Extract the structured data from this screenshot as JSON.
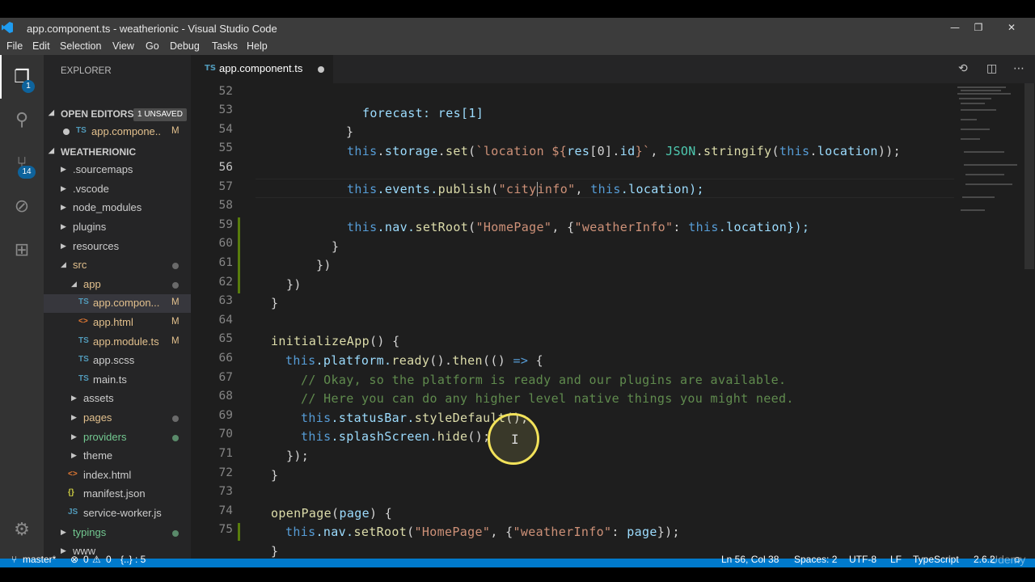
{
  "window": {
    "title": "app.component.ts - weatherionic - Visual Studio Code",
    "controls": [
      "—",
      "❐",
      "✕"
    ]
  },
  "menu": [
    "File",
    "Edit",
    "Selection",
    "View",
    "Go",
    "Debug",
    "Tasks",
    "Help"
  ],
  "activity": {
    "explorer_badge": "1",
    "scm_badge": "14"
  },
  "sidebar": {
    "header": "EXPLORER",
    "open_editors": {
      "label": "OPEN EDITORS",
      "badge": "1 UNSAVED",
      "files": [
        {
          "name": "app.compone..",
          "icon": "TS",
          "status": "M"
        }
      ]
    },
    "project": {
      "label": "WEATHERIONIC",
      "items": [
        {
          "name": ".sourcemaps",
          "type": "folder",
          "depth": 1
        },
        {
          "name": ".vscode",
          "type": "folder",
          "depth": 1
        },
        {
          "name": "node_modules",
          "type": "folder",
          "depth": 1
        },
        {
          "name": "plugins",
          "type": "folder",
          "depth": 1
        },
        {
          "name": "resources",
          "type": "folder",
          "depth": 1
        },
        {
          "name": "src",
          "type": "folder-open",
          "depth": 1
        },
        {
          "name": "app",
          "type": "folder-open",
          "depth": 2
        },
        {
          "name": "app.compon...",
          "type": "ts",
          "depth": 3,
          "status": "M"
        },
        {
          "name": "app.html",
          "type": "html",
          "depth": 3,
          "status": "M"
        },
        {
          "name": "app.module.ts",
          "type": "ts",
          "depth": 3,
          "status": "M"
        },
        {
          "name": "app.scss",
          "type": "scss",
          "depth": 3
        },
        {
          "name": "main.ts",
          "type": "ts",
          "depth": 3
        },
        {
          "name": "assets",
          "type": "folder",
          "depth": 2
        },
        {
          "name": "pages",
          "type": "folder",
          "depth": 2
        },
        {
          "name": "providers",
          "type": "folder",
          "depth": 2
        },
        {
          "name": "theme",
          "type": "folder",
          "depth": 2
        },
        {
          "name": "index.html",
          "type": "html",
          "depth": 2
        },
        {
          "name": "manifest.json",
          "type": "json",
          "depth": 2
        },
        {
          "name": "service-worker.js",
          "type": "js",
          "depth": 2
        },
        {
          "name": "typings",
          "type": "folder",
          "depth": 1
        },
        {
          "name": "www",
          "type": "folder",
          "depth": 1
        }
      ]
    }
  },
  "editor": {
    "tab": {
      "icon": "TS",
      "name": "app.component.ts"
    },
    "line_numbers": [
      "52",
      "53",
      "54",
      "55",
      "56",
      "57",
      "58",
      "59",
      "60",
      "61",
      "62",
      "63",
      "64",
      "65",
      "66",
      "67",
      "68",
      "69",
      "70",
      "71",
      "72",
      "73",
      "74",
      "75"
    ],
    "code": {
      "l52": "forecast: res[1]",
      "l53": "}",
      "l54_a": "this",
      "l54_b": ".",
      "l54_c": "storage",
      "l54_d": ".",
      "l54_e": "set",
      "l54_f": "(",
      "l54_g": "`location ${",
      "l54_h": "res",
      "l54_i": "[0].",
      "l54_j": "id",
      "l54_k": "}`",
      "l54_l": ", ",
      "l54_m": "JSON",
      "l54_n": ".",
      "l54_o": "stringify",
      "l54_p": "(",
      "l54_q": "this",
      "l54_r": ".",
      "l54_s": "location",
      "l54_t": "));",
      "l56_a": "this",
      "l56_b": ".events.",
      "l56_c": "publish",
      "l56_d": "(",
      "l56_e": "\"city",
      "l56_f": "info\"",
      "l56_g": ", ",
      "l56_h": "this",
      "l56_i": ".location);",
      "l58_a": "this",
      "l58_b": ".nav.",
      "l58_c": "setRoot",
      "l58_d": "(",
      "l58_e": "\"HomePage\"",
      "l58_f": ", {",
      "l58_g": "\"weatherInfo\"",
      "l58_h": ": ",
      "l58_i": "this",
      "l58_j": ".location});",
      "l59": "}",
      "l60": "})",
      "l61": "})",
      "l62": "}",
      "l64_a": "initializeApp",
      "l64_b": "() {",
      "l65_a": "this",
      "l65_b": ".platform.",
      "l65_c": "ready",
      "l65_d": "().",
      "l65_e": "then",
      "l65_f": "(() ",
      "l65_g": "=>",
      "l65_h": " {",
      "l66": "// Okay, so the platform is ready and our plugins are available.",
      "l67": "// Here you can do any higher level native things you might need.",
      "l68_a": "this",
      "l68_b": ".statusBar.",
      "l68_c": "styleDefault",
      "l68_d": "();",
      "l69_a": "this",
      "l69_b": ".splashScreen.",
      "l69_c": "hide",
      "l69_d": "();",
      "l70": "});",
      "l71": "}",
      "l73_a": "openPage",
      "l73_b": "(",
      "l73_c": "page",
      "l73_d": ") {",
      "l74_a": "this",
      "l74_b": ".nav.",
      "l74_c": "setRoot",
      "l74_d": "(",
      "l74_e": "\"HomePage\"",
      "l74_f": ", {",
      "l74_g": "\"weatherInfo\"",
      "l74_h": ": ",
      "l74_i": "page",
      "l74_j": "});",
      "l75": "}"
    }
  },
  "statusbar": {
    "branch": "master*",
    "errors": "0",
    "warnings": "0",
    "braces": "{..} : 5",
    "position": "Ln 56, Col 38",
    "spaces": "Spaces: 2",
    "encoding": "UTF-8",
    "eol": "LF",
    "language": "TypeScript",
    "version": "2.6.2",
    "watermark": "Udemy"
  },
  "colors": {
    "accent": "#007acc",
    "background": "#1e1e1e",
    "sidebar": "#252526",
    "activity_bar": "#333333"
  }
}
